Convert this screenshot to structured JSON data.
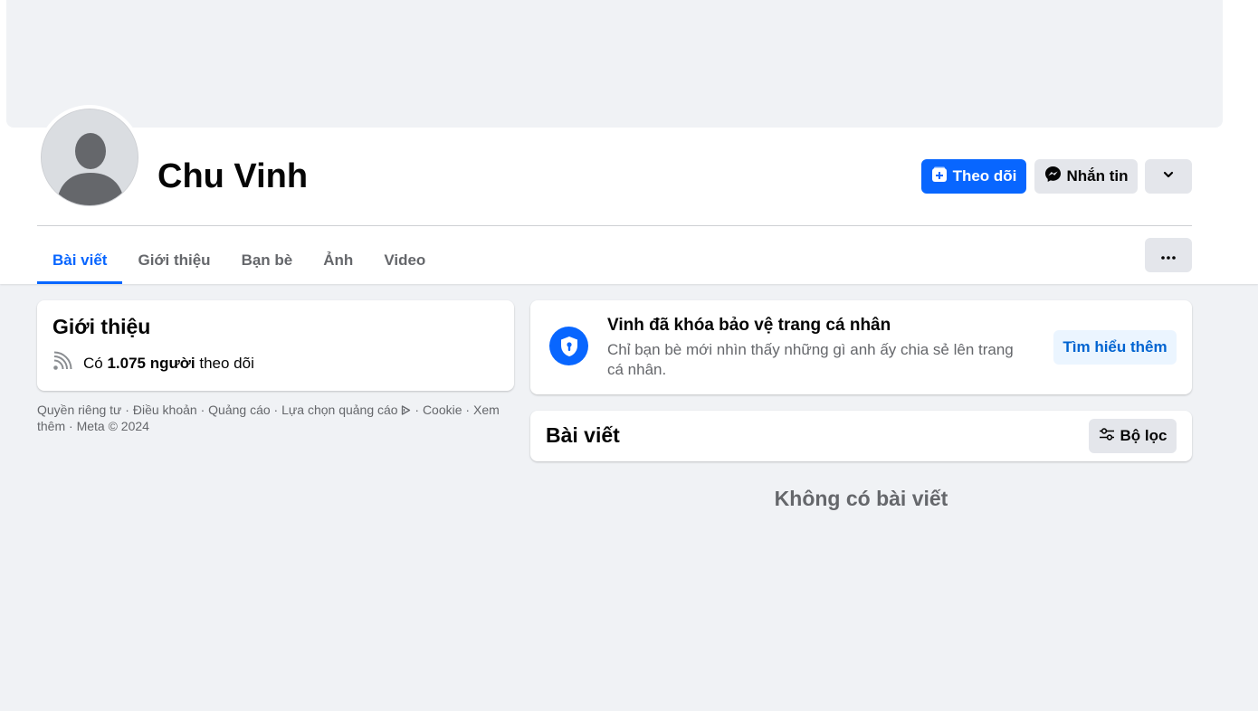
{
  "profile": {
    "name": "Chu Vinh",
    "follow_label": "Theo dõi",
    "message_label": "Nhắn tin"
  },
  "tabs": [
    {
      "label": "Bài viết",
      "active": true
    },
    {
      "label": "Giới thiệu",
      "active": false
    },
    {
      "label": "Bạn bè",
      "active": false
    },
    {
      "label": "Ảnh",
      "active": false
    },
    {
      "label": "Video",
      "active": false
    }
  ],
  "intro": {
    "title": "Giới thiệu",
    "followers_prefix": "Có",
    "followers_count": "1.075 người",
    "followers_suffix": "theo dõi"
  },
  "footer": {
    "privacy": "Quyền riêng tư",
    "terms": "Điều khoản",
    "ads": "Quảng cáo",
    "ad_choices": "Lựa chọn quảng cáo",
    "cookie": "Cookie",
    "more": "Xem thêm",
    "copyright": "Meta © 2024"
  },
  "locked": {
    "title": "Vinh đã khóa bảo vệ trang cá nhân",
    "description": "Chỉ bạn bè mới nhìn thấy những gì anh ấy chia sẻ lên trang cá nhân.",
    "learn_more_label": "Tìm hiểu thêm"
  },
  "posts": {
    "title": "Bài viết",
    "filter_label": "Bộ lọc",
    "empty_message": "Không có bài viết"
  },
  "colors": {
    "primary": "#0866ff",
    "background": "#f0f2f5",
    "secondary_button": "#e4e6eb",
    "muted_text": "#65676b"
  }
}
